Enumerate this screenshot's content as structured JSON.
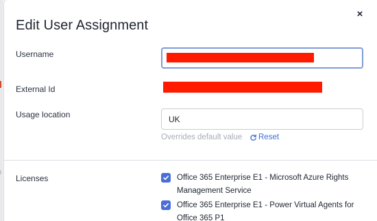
{
  "dialog": {
    "title": "Edit User Assignment",
    "close_glyph": "×"
  },
  "fields": {
    "username": {
      "label": "Username",
      "value": ""
    },
    "external_id": {
      "label": "External Id",
      "value": ""
    },
    "usage_location": {
      "label": "Usage location",
      "value": "UK",
      "hint": "Overrides default value",
      "reset_label": "Reset"
    }
  },
  "licenses": {
    "label": "Licenses",
    "items": [
      {
        "label": "Office 365 Enterprise E1 - Microsoft Azure Rights Management Service",
        "checked": true
      },
      {
        "label": "Office 365 Enterprise E1 - Power Virtual Agents for Office 365 P1",
        "checked": true
      }
    ]
  },
  "colors": {
    "accent": "#3b6fd1",
    "checkbox": "#4a6ed8",
    "redaction": "#ff1a00",
    "focus_border": "#7e9bd8"
  },
  "icons": {
    "close": "close-icon",
    "reset": "reset-icon",
    "check": "check-icon"
  }
}
